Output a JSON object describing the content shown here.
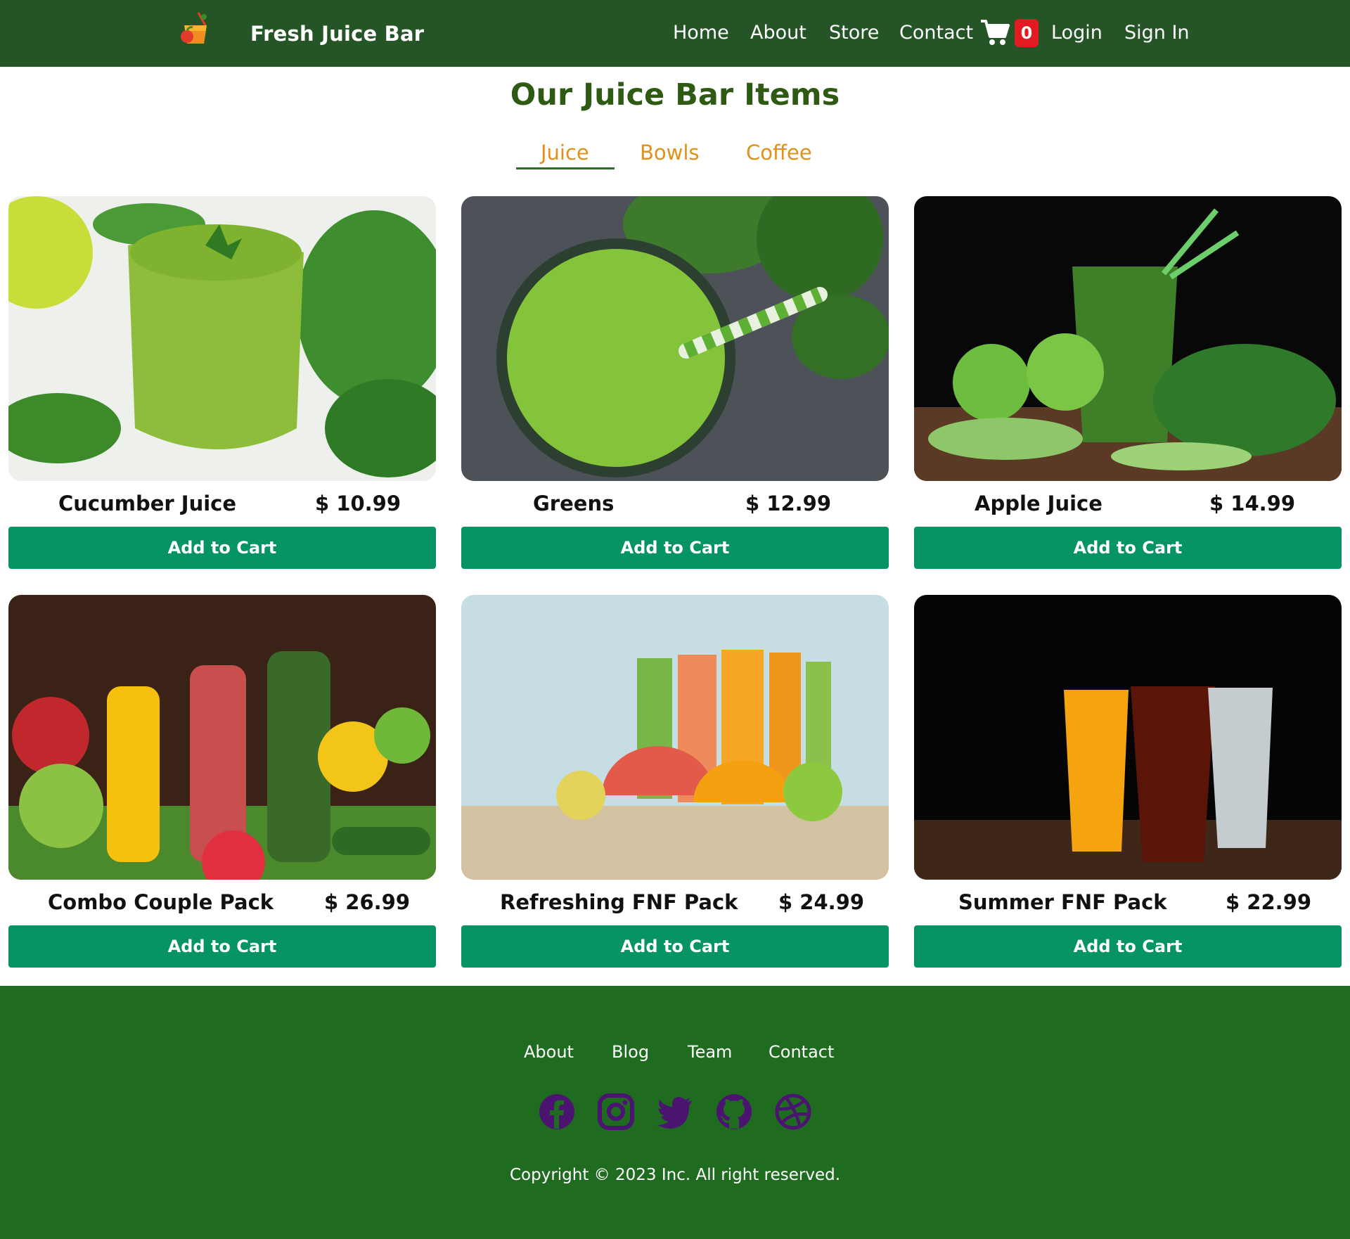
{
  "header": {
    "brand": "Fresh Juice Bar",
    "logo_icon": "juice-logo-icon",
    "nav": [
      "Home",
      "About",
      "Store",
      "Contact"
    ],
    "cart_icon": "cart-icon",
    "cart_count": "0",
    "login": "Login",
    "sign_in": "Sign In"
  },
  "main": {
    "title": "Our Juice Bar Items",
    "tabs": [
      "Juice",
      "Bowls",
      "Coffee"
    ],
    "active_tab": "Juice",
    "products": [
      {
        "name": "Cucumber Juice",
        "price": "$ 10.99",
        "button": "Add to Cart"
      },
      {
        "name": "Greens",
        "price": "$ 12.99",
        "button": "Add to Cart"
      },
      {
        "name": "Apple Juice",
        "price": "$ 14.99",
        "button": "Add to Cart"
      },
      {
        "name": "Combo Couple Pack",
        "price": "$ 26.99",
        "button": "Add to Cart"
      },
      {
        "name": "Refreshing FNF Pack",
        "price": "$ 24.99",
        "button": "Add to Cart"
      },
      {
        "name": "Summer FNF Pack",
        "price": "$ 22.99",
        "button": "Add to Cart"
      }
    ]
  },
  "footer": {
    "links": [
      "About",
      "Blog",
      "Team",
      "Contact"
    ],
    "social_icons": [
      "facebook-icon",
      "instagram-icon",
      "twitter-icon",
      "github-icon",
      "dribbble-icon"
    ],
    "copyright": "Copyright © 2023 Inc. All right reserved."
  },
  "colors": {
    "header_bg": "#255526",
    "footer_bg": "#1f6c21",
    "title": "#2e5a14",
    "tab": "#e0911a",
    "button": "#069465",
    "badge": "#e21b23",
    "social_icon": "#4a1470"
  }
}
